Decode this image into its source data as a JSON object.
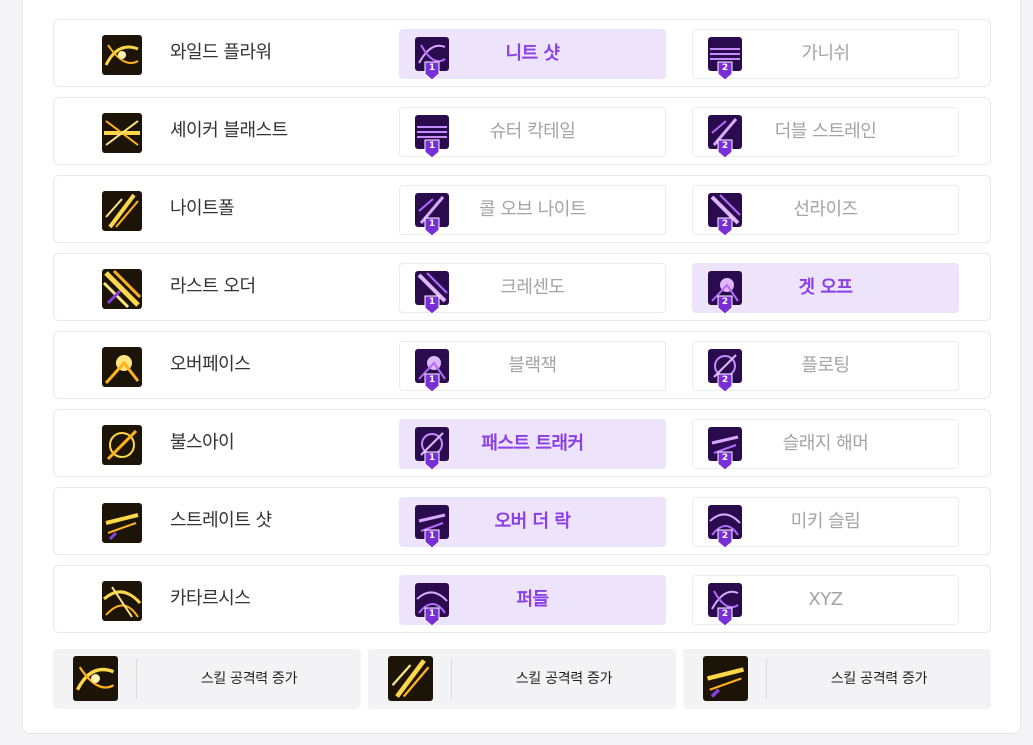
{
  "colors": {
    "accent": "#8b3fe6",
    "selected_bg": "#ede4fc",
    "muted_text": "#a3a3a8",
    "skill_text": "#333333"
  },
  "skills": [
    {
      "name": "와일드 플라워",
      "icon": "gold-swirl-skill-icon",
      "options": [
        {
          "num": "1",
          "label": "니트 샷",
          "selected": true
        },
        {
          "num": "2",
          "label": "가니쉬",
          "selected": false
        }
      ]
    },
    {
      "name": "셰이커 블래스트",
      "icon": "gold-burst-skill-icon",
      "options": [
        {
          "num": "1",
          "label": "슈터 칵테일",
          "selected": false
        },
        {
          "num": "2",
          "label": "더블 스트레인",
          "selected": false
        }
      ]
    },
    {
      "name": "나이트폴",
      "icon": "gold-slash-skill-icon",
      "options": [
        {
          "num": "1",
          "label": "콜 오브 나이트",
          "selected": false
        },
        {
          "num": "2",
          "label": "선라이즈",
          "selected": false
        }
      ]
    },
    {
      "name": "라스트 오더",
      "icon": "gold-stripes-skill-icon",
      "options": [
        {
          "num": "1",
          "label": "크레센도",
          "selected": false
        },
        {
          "num": "2",
          "label": "겟 오프",
          "selected": true
        }
      ]
    },
    {
      "name": "오버페이스",
      "icon": "gold-flare-skill-icon",
      "options": [
        {
          "num": "1",
          "label": "블랙잭",
          "selected": false
        },
        {
          "num": "2",
          "label": "플로팅",
          "selected": false
        }
      ]
    },
    {
      "name": "불스아이",
      "icon": "gold-target-skill-icon",
      "options": [
        {
          "num": "1",
          "label": "패스트 트래커",
          "selected": true
        },
        {
          "num": "2",
          "label": "슬래지 해머",
          "selected": false
        }
      ]
    },
    {
      "name": "스트레이트 샷",
      "icon": "gold-shot-skill-icon",
      "options": [
        {
          "num": "1",
          "label": "오버 더 락",
          "selected": true
        },
        {
          "num": "2",
          "label": "미키 슬림",
          "selected": false
        }
      ]
    },
    {
      "name": "카타르시스",
      "icon": "gold-catharsis-skill-icon",
      "options": [
        {
          "num": "1",
          "label": "퍼들",
          "selected": true
        },
        {
          "num": "2",
          "label": "XYZ",
          "selected": false
        }
      ]
    }
  ],
  "boosts": [
    {
      "label": "스킬 공격력 증가",
      "icon": "skill-damage-boost-icon"
    },
    {
      "label": "스킬 공격력 증가",
      "icon": "skill-damage-boost-icon"
    },
    {
      "label": "스킬 공격력 증가",
      "icon": "skill-damage-boost-icon"
    }
  ]
}
